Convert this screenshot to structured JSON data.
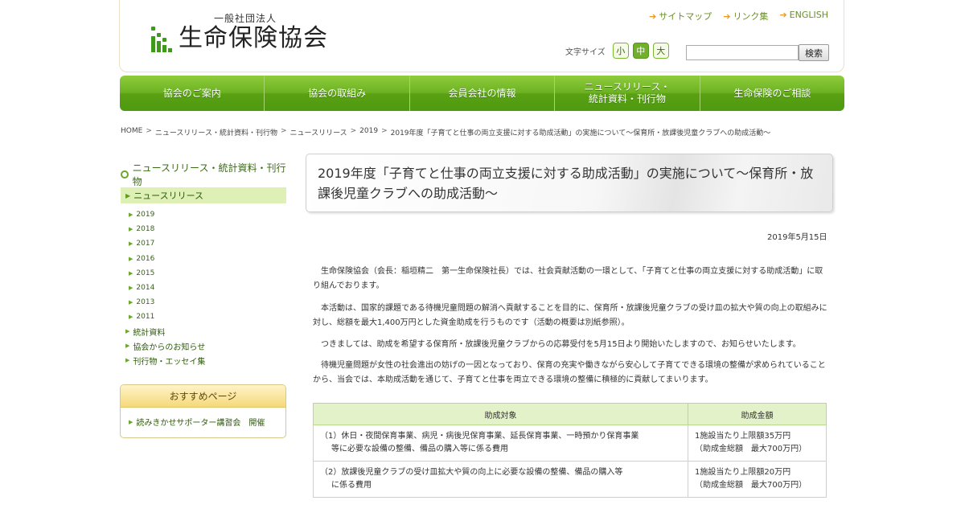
{
  "header": {
    "logo_sub": "一般社団法人",
    "logo_main": "生命保険協会",
    "top_links": [
      "サイトマップ",
      "リンク集",
      "ENGLISH"
    ],
    "font_size_label": "文字サイズ",
    "font_sizes": [
      "小",
      "中",
      "大"
    ],
    "font_size_active": "中",
    "search_placeholder": "",
    "search_button": "検索"
  },
  "nav": {
    "items": [
      "協会のご案内",
      "協会の取組み",
      "会員会社の情報",
      "ニュースリリース・\n統計資料・刊行物",
      "生命保険のご相談"
    ]
  },
  "breadcrumb": [
    "HOME",
    "ニュースリリース・統計資料・刊行物",
    "ニュースリリース",
    "2019",
    "2019年度「子育てと仕事の両立支援に対する助成活動」の実施について～保育所・放課後児童クラブへの助成活動～"
  ],
  "sidebar": {
    "title": "ニュースリリース・統計資料・刊行物",
    "active": "ニュースリリース",
    "years": [
      "2019",
      "2018",
      "2017",
      "2016",
      "2015",
      "2014",
      "2013",
      "2011"
    ],
    "links": [
      "統計資料",
      "協会からのお知らせ",
      "刊行物・エッセイ集"
    ],
    "recommend_title": "おすすめページ",
    "recommend_item": "読みきかせサポーター講習会　開催"
  },
  "article": {
    "title": "2019年度「子育てと仕事の両立支援に対する助成活動」の実施について～保育所・放課後児童クラブへの助成活動～",
    "date": "2019年5月15日",
    "paragraphs": [
      "生命保険協会（会長：稲垣精二　第一生命保険社長）では、社会貢献活動の一環として、「子育てと仕事の両立支援に対する助成活動」に取り組んでおります。",
      "本活動は、国家的課題である待機児童問題の解消へ貢献することを目的に、保育所・放課後児童クラブの受け皿の拡大や質の向上の取組みに対し、総額を最大1,400万円とした資金助成を行うものです（活動の概要は別紙参照）。",
      "つきましては、助成を希望する保育所・放課後児童クラブからの応募受付を5月15日より開始いたしますので、お知らせいたします。",
      "待機児童問題が女性の社会進出の妨げの一因となっており、保育の充実や働きながら安心して子育てできる環境の整備が求められていることから、当会では、本助成活動を通じて、子育てと仕事を両立できる環境の整備に積極的に貢献してまいります。"
    ],
    "table": {
      "headers": [
        "助成対象",
        "助成金額"
      ],
      "rows": [
        {
          "target_line1": "（1）休日・夜間保育事業、病児・病後児保育事業、延長保育事業、一時預かり保育事業",
          "target_line2": "等に必要な設備の整備、備品の購入等に係る費用",
          "amount_line1": "1施設当たり上限額35万円",
          "amount_line2": "（助成金総額　最大700万円）"
        },
        {
          "target_line1": "（2）放課後児童クラブの受け皿拡大や質の向上に必要な設備の整備、備品の購入等",
          "target_line2": "に係る費用",
          "amount_line1": "1施設当たり上限額20万円",
          "amount_line2": "（助成金総額　最大700万円）"
        }
      ]
    }
  },
  "colors": {
    "brand_green": "#5aa013",
    "nav_light_green": "#8fcc3c",
    "highlight_bg": "#def0b6",
    "table_header_bg": "#e3f2c8",
    "recommend_header": "#f5d97a"
  }
}
